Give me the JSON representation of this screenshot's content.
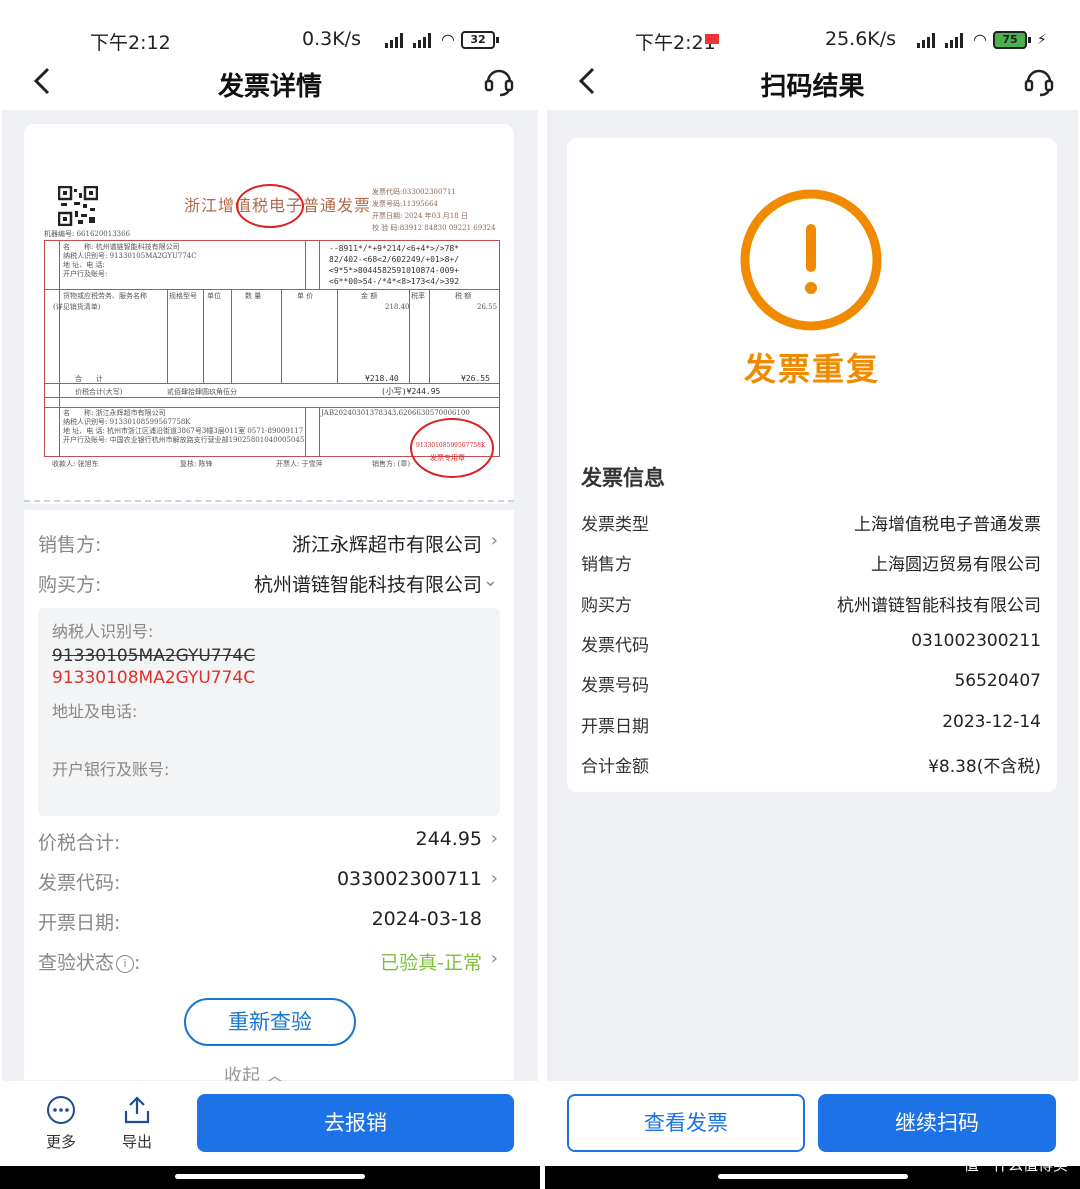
{
  "left": {
    "status": {
      "time": "下午2:12",
      "net": "0.3K/s",
      "battery": "32"
    },
    "nav": {
      "title": "发票详情"
    },
    "invoice_image": {
      "title": "浙江增值税电子普通发票",
      "meta_lines": [
        "发票代码:033002300711",
        "发票号码:11395664",
        "开票日期: 2024 年03 月18 日",
        "校 验 码:83912 84830 09221 69324"
      ],
      "machine_no": "机器编号: 661620013366",
      "buyer_lines": [
        "名　　称: 杭州谱链智能科技有限公司",
        "纳税人识别号: 91330105MA2GYU774C",
        "地 址、电 话:",
        "开户行及账号:"
      ],
      "cipher_lines": [
        "--8911*/*+9*214/<6+4*>/>78*",
        "82/402-<68<2/602249/+01>8+/",
        "<9*5*>8044582591010874-009+",
        "<6**00>54-/*4*<8>173<4/>392"
      ],
      "items_header": [
        "货物或应税劳务、服务名称",
        "规格型号",
        "单位",
        "数 量",
        "单 价",
        "金 额",
        "税率",
        "税 额"
      ],
      "item_line": "(详见销货清单)",
      "amount": "218.40",
      "tax": "26.55",
      "total_label": "合　　计",
      "total_amount": "¥218.40",
      "total_tax": "¥26.55",
      "grand_label": "价税合计(大写)",
      "grand_words": "贰佰肆拾肆圆玖角伍分",
      "grand_small": "(小写)¥244.95",
      "seller_lines": [
        "名　　称: 浙江永辉超市有限公司",
        "纳税人识别号: 91330108599567758K",
        "地 址、电 话: 杭州市浙江区浦沿街道3867号3幢3层011室 0571-89009117",
        "开户行及账号: 中国农业银行杭州市解放路支行营业部19025801040005045"
      ],
      "remark": "JAB20240301378343.6206630570006100",
      "signers": [
        "收款人: 张旭东",
        "复核: 陈锋",
        "开票人: 于雪萍",
        "销售方: (章)"
      ],
      "stamp_text": "91330108599567758K",
      "stamp_label": "发票专用章"
    },
    "details": {
      "seller_label": "销售方:",
      "seller": "浙江永辉超市有限公司",
      "buyer_label": "购买方:",
      "buyer": "杭州谱链智能科技有限公司",
      "taxid_label": "纳税人识别号:",
      "taxid_old": "91330105MA2GYU774C",
      "taxid_new": "91330108MA2GYU774C",
      "addr_label": "地址及电话:",
      "bank_label": "开户银行及账号:",
      "total_label": "价税合计:",
      "total": "244.95",
      "code_label": "发票代码:",
      "code": "033002300711",
      "date_label": "开票日期:",
      "date": "2024-03-18",
      "status_label": "查验状态",
      "status_colon": ":",
      "status": "已验真-正常",
      "recheck": "重新查验",
      "collapse": "收起"
    },
    "toolbar": {
      "more": "更多",
      "export": "导出",
      "reimburse": "去报销"
    }
  },
  "right": {
    "status": {
      "time": "下午2:21",
      "net": "25.6K/s",
      "battery": "75"
    },
    "nav": {
      "title": "扫码结果"
    },
    "result": "发票重复",
    "section_title": "发票信息",
    "rows": [
      {
        "k": "发票类型",
        "v": "上海增值税电子普通发票"
      },
      {
        "k": "销售方",
        "v": "上海圆迈贸易有限公司"
      },
      {
        "k": "购买方",
        "v": "杭州谱链智能科技有限公司"
      },
      {
        "k": "发票代码",
        "v": "031002300211"
      },
      {
        "k": "发票号码",
        "v": "56520407"
      },
      {
        "k": "开票日期",
        "v": "2023-12-14"
      },
      {
        "k": "合计金额",
        "v": "¥8.38(不含税)"
      }
    ],
    "buttons": {
      "view": "查看发票",
      "continue": "继续扫码"
    },
    "watermark": "值 · 什么值得买"
  },
  "colors": {
    "primary": "#1d72e8",
    "warning": "#f08a00",
    "verified": "#7cc03a",
    "error": "#e0302a"
  }
}
